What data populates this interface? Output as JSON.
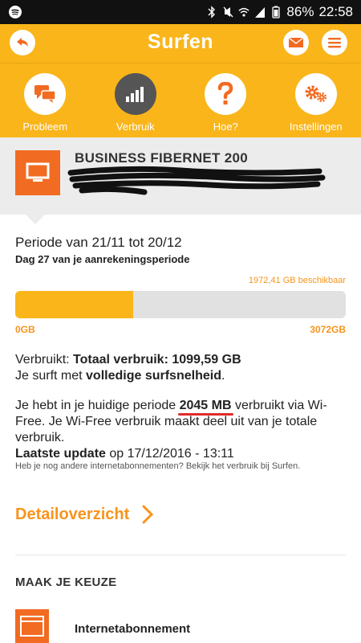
{
  "status_bar": {
    "battery": "86%",
    "time": "22:58"
  },
  "app_bar": {
    "title": "Surfen"
  },
  "tabs": [
    {
      "label": "Probleem",
      "icon": "chat-icon",
      "active": false
    },
    {
      "label": "Verbruik",
      "icon": "bar-chart-icon",
      "active": true
    },
    {
      "label": "Hoe?",
      "icon": "question-icon",
      "active": false
    },
    {
      "label": "Instellingen",
      "icon": "gears-icon",
      "active": false
    }
  ],
  "product": {
    "name": "BUSINESS FIBERNET 200"
  },
  "usage": {
    "periode": "Periode van 21/11 tot 20/12",
    "dag": "Dag 27 van je aanrekeningsperiode",
    "available": "1972,41 GB beschikbaar",
    "used_fraction": 0.358,
    "min_label": "0GB",
    "max_label": "3072GB"
  },
  "verbruik": {
    "label": "Verbruikt:",
    "total": "Totaal verbruik: 1099,59 GB",
    "surf_prefix": "Je surft met",
    "surf_speed": "volledige surfsnelheid",
    "surf_suffix": "."
  },
  "wifree": {
    "prefix": "Je hebt in je huidige periode",
    "amount": "2045 MB",
    "suffix": "verbruikt via Wi-Free. Je Wi-Free verbruik maakt deel uit van je totale verbruik.",
    "update_label": "Laatste update",
    "update_value": "op 17/12/2016 - 13:11",
    "note": "Heb je nog andere internetabonnementen? Bekijk het verbruik bij Surfen."
  },
  "detail_link": "Detailoverzicht",
  "choose_heading": "MAAK JE KEUZE",
  "sub_item": {
    "label": "Internetabonnement"
  },
  "colors": {
    "yellow": "#f9b51a",
    "orange": "#f26b22",
    "accent_text": "#f7941d",
    "dark_tab": "#555555"
  }
}
